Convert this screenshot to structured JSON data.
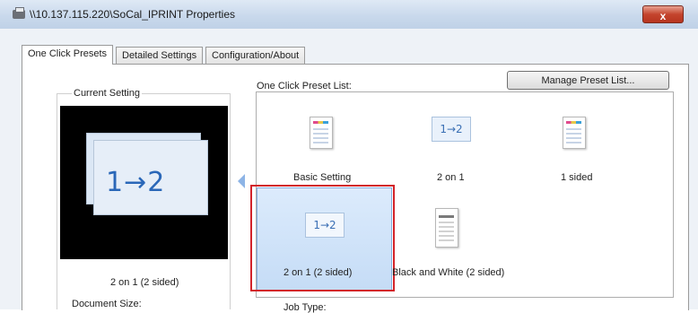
{
  "window": {
    "title": "\\\\10.137.115.220\\SoCal_IPRINT Properties",
    "close_label": "x"
  },
  "tabs": [
    {
      "label": "One Click Presets",
      "active": true
    },
    {
      "label": "Detailed Settings",
      "active": false
    },
    {
      "label": "Configuration/About",
      "active": false
    }
  ],
  "current_setting": {
    "group_label": "Current Setting",
    "preview_text": "1→2",
    "caption": "2 on 1 (2 sided)",
    "document_size_label": "Document Size:"
  },
  "preset_list": {
    "label": "One Click Preset List:",
    "manage_button": "Manage Preset List...",
    "items": [
      {
        "label": "Basic Setting",
        "icon": "color-document-icon"
      },
      {
        "label": "2 on 1",
        "icon": "two-up-icon",
        "icon_text": "1→2"
      },
      {
        "label": "1 sided",
        "icon": "color-document-icon"
      },
      {
        "label": "2 on 1 (2 sided)",
        "icon": "two-up-icon",
        "icon_text": "1→2",
        "selected": true
      },
      {
        "label": "Black and White (2 sided)",
        "icon": "grayscale-document-icon"
      }
    ]
  },
  "job_type_label": "Job Type:",
  "colors": {
    "highlight": "#d2232a",
    "selection": "#c5dcf6",
    "accent_blue": "#2a67b8"
  }
}
